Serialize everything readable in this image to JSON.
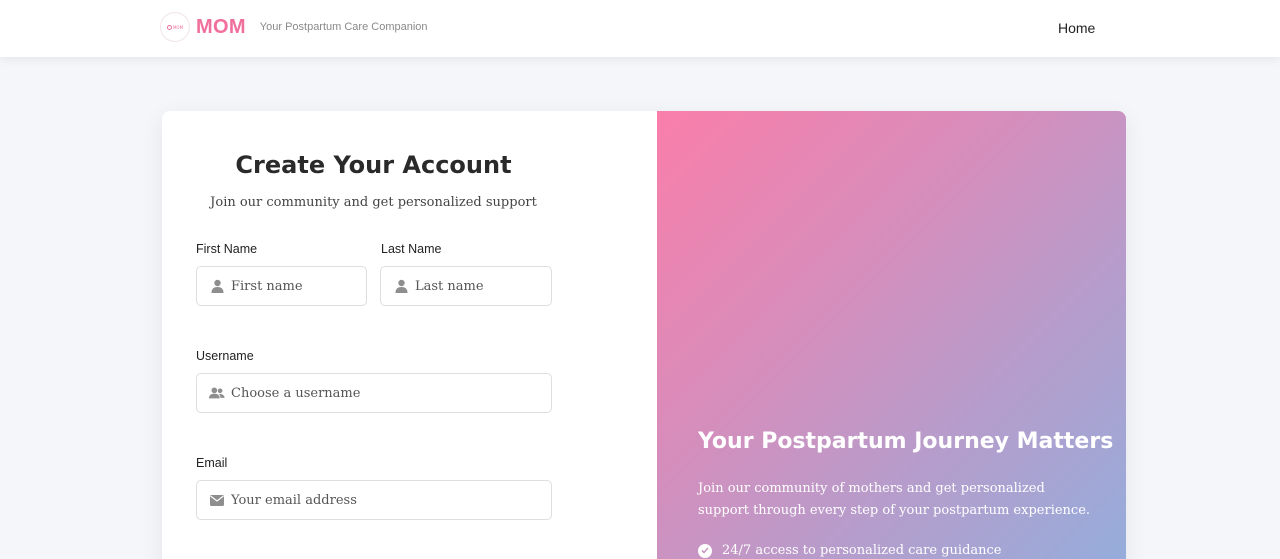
{
  "header": {
    "brand_name": "MOM",
    "tagline": "Your Postpartum Care Companion",
    "nav": {
      "home": "Home"
    }
  },
  "form": {
    "title": "Create Your Account",
    "subtitle": "Join our community and get personalized support",
    "first_name": {
      "label": "First Name",
      "placeholder": "First name",
      "icon": "user-icon"
    },
    "last_name": {
      "label": "Last Name",
      "placeholder": "Last name",
      "icon": "user-icon"
    },
    "username": {
      "label": "Username",
      "placeholder": "Choose a username",
      "icon": "users-icon"
    },
    "email": {
      "label": "Email",
      "placeholder": "Your email address",
      "icon": "envelope-icon"
    }
  },
  "hero": {
    "title": "Your Postpartum Journey Matters",
    "text": "Join our community of mothers and get personalized support through every step of your postpartum experience.",
    "features": [
      "24/7 access to personalized care guidance"
    ]
  },
  "colors": {
    "brand": "#f06f9c",
    "gradient_start": "#fa7eaa",
    "gradient_end": "#93aedc",
    "page_background": "#f5f6fa"
  }
}
